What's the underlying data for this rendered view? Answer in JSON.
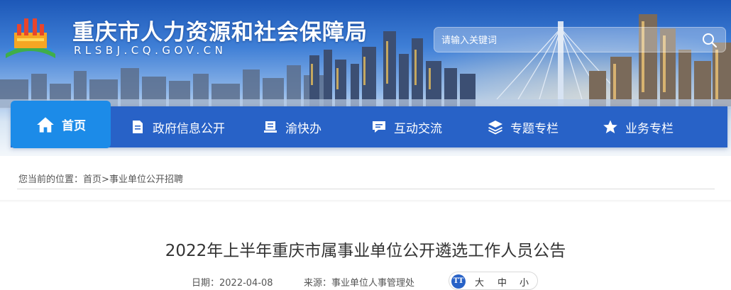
{
  "header": {
    "site_title": "重庆市人力资源和社会保障局",
    "site_domain": "RLSBJ.CQ.GOV.CN"
  },
  "search": {
    "placeholder": "请输入关键词"
  },
  "nav": {
    "items": [
      {
        "label": "首页",
        "icon": "home-icon",
        "active": true
      },
      {
        "label": "政府信息公开",
        "icon": "document-icon"
      },
      {
        "label": "渝快办",
        "icon": "stack-icon"
      },
      {
        "label": "互动交流",
        "icon": "chat-icon"
      },
      {
        "label": "专题专栏",
        "icon": "layers-icon"
      },
      {
        "label": "业务专栏",
        "icon": "star-icon"
      }
    ]
  },
  "breadcrumb": {
    "prefix": "您当前的位置：",
    "home": "首页",
    "separator": ">",
    "current": "事业单位公开招聘"
  },
  "article": {
    "title": "2022年上半年重庆市属事业单位公开遴选工作人员公告",
    "date_label": "日期：",
    "date": "2022-04-08",
    "source_label": "来源：",
    "source": "事业单位人事管理处",
    "font_size": {
      "icon_text": "TT",
      "options": [
        "大",
        "中",
        "小"
      ]
    }
  },
  "colors": {
    "nav_bg": "#2862c7",
    "nav_active": "#1c8be8"
  }
}
